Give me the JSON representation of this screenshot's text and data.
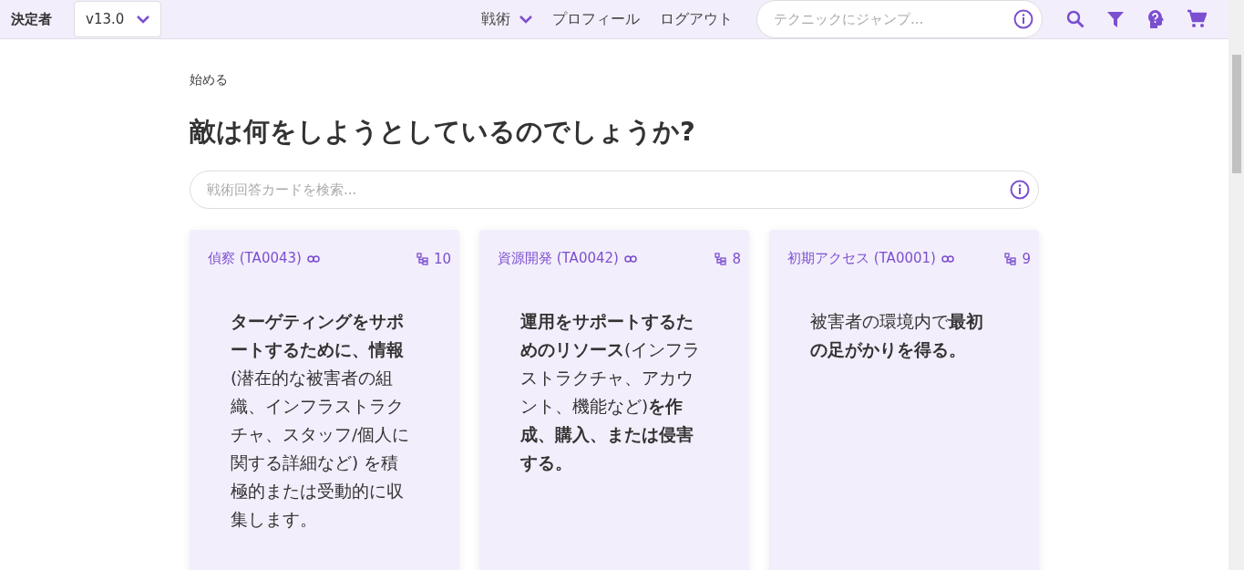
{
  "header": {
    "brand": "決定者",
    "version": "v13.0",
    "nav": [
      {
        "label": "戦術",
        "dropdown": true
      },
      {
        "label": "プロフィール",
        "dropdown": false
      },
      {
        "label": "ログアウト",
        "dropdown": false
      }
    ],
    "search": {
      "placeholder": "テクニックにジャンプ..."
    }
  },
  "breadcrumb": "始める",
  "title": "敵は何をしようとしているのでしょうか?",
  "card_search": {
    "placeholder": "戦術回答カードを検索..."
  },
  "cards": [
    {
      "title": "偵察 (TA0043)",
      "count": "10",
      "description": "**ターゲティングをサポートするために、情報** (潜在的な被害者の組織、インフラストラクチャ、スタッフ/個人に関する詳細など) を積極的または受動的に収集します。"
    },
    {
      "title": "資源開発 (TA0042)",
      "count": "8",
      "description": "**運用をサポートするためのリソース**(インフラストラクチャ、アカウント、機能など)**を作成、購入、または侵害する。**"
    },
    {
      "title": "初期アクセス (TA0001)",
      "count": "9",
      "description": "被害者の環境内で**最初の足がかりを得る。**"
    }
  ]
}
